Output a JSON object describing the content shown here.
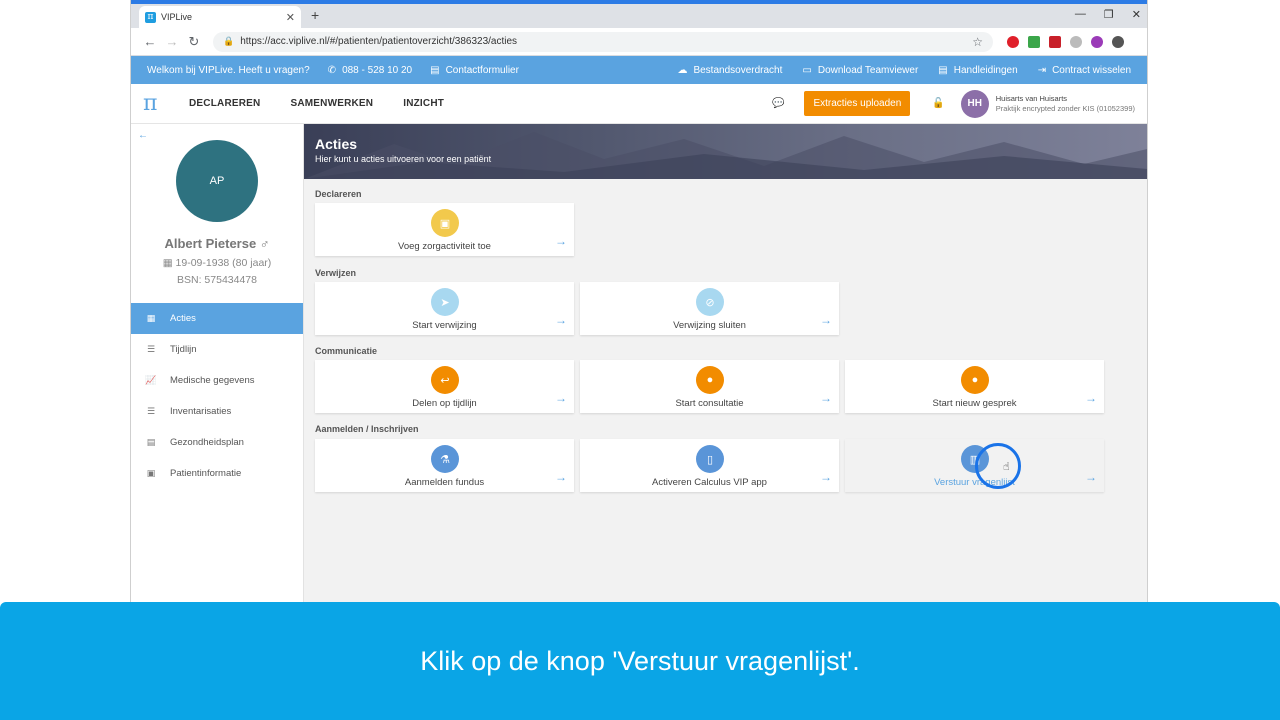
{
  "browser": {
    "tab_title": "VIPLive",
    "tab_close": "✕",
    "new_tab": "+",
    "window_controls": [
      "—",
      "❐",
      "✕"
    ],
    "url": "https://acc.viplive.nl/#/patienten/patientoverzicht/386323/acties"
  },
  "infobar": {
    "welcome": "Welkom bij VIPLive. Heeft u vragen?",
    "phone": "088 - 528 10 20",
    "contact": "Contactformulier",
    "transfer": "Bestandsoverdracht",
    "teamviewer": "Download Teamviewer",
    "manuals": "Handleidingen",
    "switch": "Contract wisselen"
  },
  "appbar": {
    "logo": "π",
    "nav": [
      "DECLAREREN",
      "SAMENWERKEN",
      "INZICHT"
    ],
    "upload_button": "Extracties uploaden",
    "user_initials": "HH",
    "user_name": "Huisarts van Huisarts",
    "user_sub": "Praktijk encrypted zonder KIS (01052399)"
  },
  "patient": {
    "initials": "AP",
    "name": "Albert Pieterse ♂",
    "dob": "19-09-1938  (80 jaar)",
    "bsn": "BSN: 575434478"
  },
  "sidebar": {
    "items": [
      {
        "label": "Acties",
        "icon": "calendar-icon"
      },
      {
        "label": "Tijdlijn",
        "icon": "list-icon"
      },
      {
        "label": "Medische gegevens",
        "icon": "chart-icon"
      },
      {
        "label": "Inventarisaties",
        "icon": "list-icon"
      },
      {
        "label": "Gezondheidsplan",
        "icon": "file-icon"
      },
      {
        "label": "Patientinformatie",
        "icon": "id-card-icon"
      }
    ]
  },
  "hero": {
    "title": "Acties",
    "subtitle": "Hier kunt u acties uitvoeren voor een patiënt"
  },
  "sections": {
    "declareren": "Declareren",
    "verwijzen": "Verwijzen",
    "communicatie": "Communicatie",
    "aanmelden": "Aanmelden / Inschrijven"
  },
  "cards": {
    "zorgactiviteit": "Voeg zorgactiviteit toe",
    "start_verwijzing": "Start verwijzing",
    "verwijzing_sluiten": "Verwijzing sluiten",
    "delen_tijdlijn": "Delen op tijdlijn",
    "start_consultatie": "Start consultatie",
    "start_gesprek": "Start nieuw gesprek",
    "aanmelden_fundus": "Aanmelden fundus",
    "activeren_calculus": "Activeren Calculus VIP app",
    "verstuur_vragenlijst": "Verstuur vragenlijst"
  },
  "colors": {
    "primary": "#5aa3e0",
    "orange": "#f28c00",
    "yellow": "#f2c94c",
    "light_blue": "#a8d8f0",
    "teal": "#2e7280",
    "banner": "#0aa5e6"
  },
  "caption": "Klik op de knop 'Verstuur vragenlijst'."
}
